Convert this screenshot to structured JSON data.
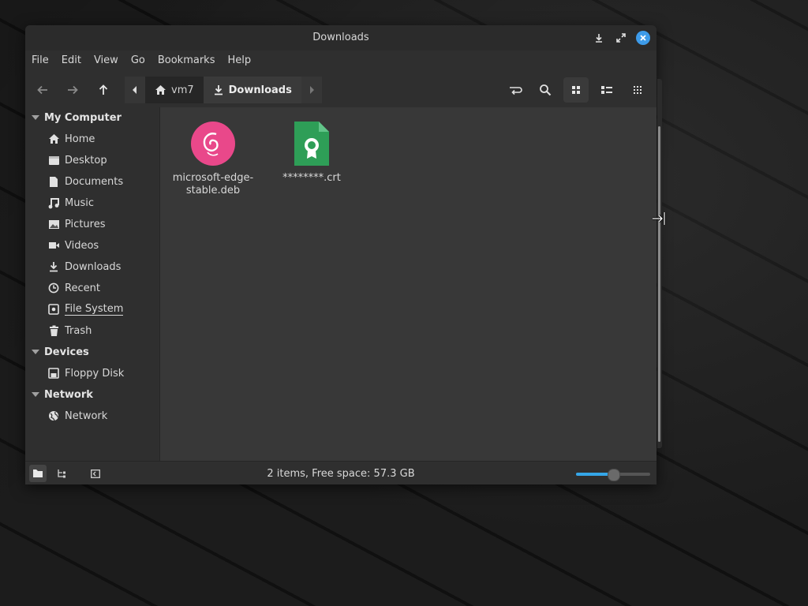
{
  "window": {
    "title": "Downloads"
  },
  "menubar": {
    "items": [
      "File",
      "Edit",
      "View",
      "Go",
      "Bookmarks",
      "Help"
    ]
  },
  "breadcrumb": {
    "home_label": "vm7",
    "current_label": "Downloads"
  },
  "sidebar": {
    "sections": [
      {
        "title": "My Computer",
        "items": [
          {
            "label": "Home",
            "icon": "home-icon"
          },
          {
            "label": "Desktop",
            "icon": "desktop-icon"
          },
          {
            "label": "Documents",
            "icon": "document-icon"
          },
          {
            "label": "Music",
            "icon": "music-icon"
          },
          {
            "label": "Pictures",
            "icon": "picture-icon"
          },
          {
            "label": "Videos",
            "icon": "video-icon"
          },
          {
            "label": "Downloads",
            "icon": "download-icon"
          },
          {
            "label": "Recent",
            "icon": "clock-icon"
          },
          {
            "label": "File System",
            "icon": "drive-icon"
          },
          {
            "label": "Trash",
            "icon": "trash-icon"
          }
        ]
      },
      {
        "title": "Devices",
        "items": [
          {
            "label": "Floppy Disk",
            "icon": "floppy-icon"
          }
        ]
      },
      {
        "title": "Network",
        "items": [
          {
            "label": "Network",
            "icon": "globe-icon"
          }
        ]
      }
    ]
  },
  "files": [
    {
      "name": "microsoft-edge-stable.deb",
      "line1": "microsoft-edge-",
      "line2": "stable.deb",
      "icon": "debian-package-icon",
      "color": "#e9488a"
    },
    {
      "name": "********.crt",
      "line1": "********.crt",
      "line2": "",
      "icon": "certificate-icon",
      "color": "#2e9e57"
    }
  ],
  "status": {
    "text": "2 items, Free space: 57.3 GB",
    "zoom_level": 0.5
  },
  "colors": {
    "accent": "#35a6e8",
    "close_button": "#3d9be9"
  }
}
